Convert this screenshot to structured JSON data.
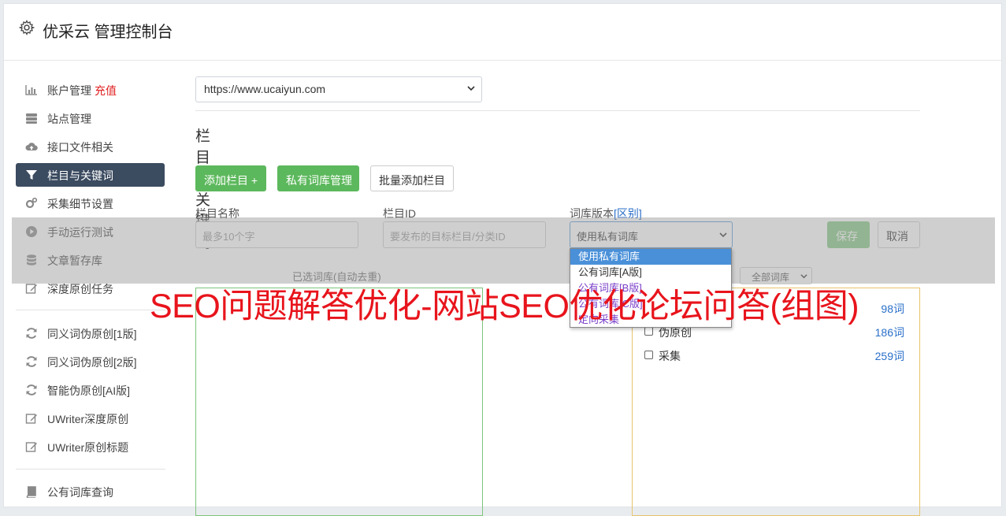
{
  "header": {
    "title": "优采云 管理控制台",
    "icon": "gear-icon"
  },
  "sidebar": {
    "items": [
      {
        "label": "账户管理",
        "badge": "充值",
        "icon": "bar-chart-icon"
      },
      {
        "label": "站点管理",
        "icon": "server-icon"
      },
      {
        "label": "接口文件相关",
        "icon": "cloud-upload-icon"
      },
      {
        "label": "栏目与关键词",
        "icon": "filter-icon",
        "active": true
      },
      {
        "label": "采集细节设置",
        "icon": "gears-icon"
      },
      {
        "label": "手动运行测试",
        "icon": "play-circle-icon"
      },
      {
        "label": "文章暂存库",
        "icon": "database-icon"
      },
      {
        "label": "深度原创任务",
        "icon": "edit-icon"
      },
      {
        "label": "同义词伪原创[1版]",
        "icon": "refresh-icon"
      },
      {
        "label": "同义词伪原创[2版]",
        "icon": "refresh-icon"
      },
      {
        "label": "智能伪原创[AI版]",
        "icon": "refresh-icon"
      },
      {
        "label": "UWriter深度原创",
        "icon": "edit-icon"
      },
      {
        "label": "UWriter原创标题",
        "icon": "edit-icon"
      },
      {
        "label": "公有词库查询",
        "icon": "book-icon"
      }
    ]
  },
  "main": {
    "site_select_value": "https://www.ucaiyun.com",
    "section_title": "栏目与关键词",
    "buttons": {
      "add_column": "添加栏目 +",
      "private_lib": "私有词库管理",
      "batch_add": "批量添加栏目"
    },
    "form": {
      "name_label": "栏目名称",
      "name_placeholder": "最多10个字",
      "id_label": "栏目ID",
      "id_placeholder": "要发布的目标栏目/分类ID",
      "version_label": "词库版本",
      "version_link": "[区别]",
      "version_value": "使用私有词库",
      "save": "保存",
      "cancel": "取消"
    },
    "dropdown_options": [
      "使用私有词库",
      "公有词库[A版]",
      "公有词库[B版]",
      "公有词库[C版]",
      "定向采集"
    ],
    "selected_label": "已选词库(自动去重)",
    "filter_select": "全部词库",
    "libraries": [
      {
        "name": "",
        "count": "98词"
      },
      {
        "name": "伪原创",
        "count": "186词"
      },
      {
        "name": "采集",
        "count": "259词"
      }
    ]
  },
  "watermark": "SEO问题解答优化-网站SEO优化论坛问答(组图)",
  "colors": {
    "accent": "#3b4b60",
    "green": "#5cb85c",
    "link": "#2a6fc9",
    "red": "#e8141c"
  }
}
